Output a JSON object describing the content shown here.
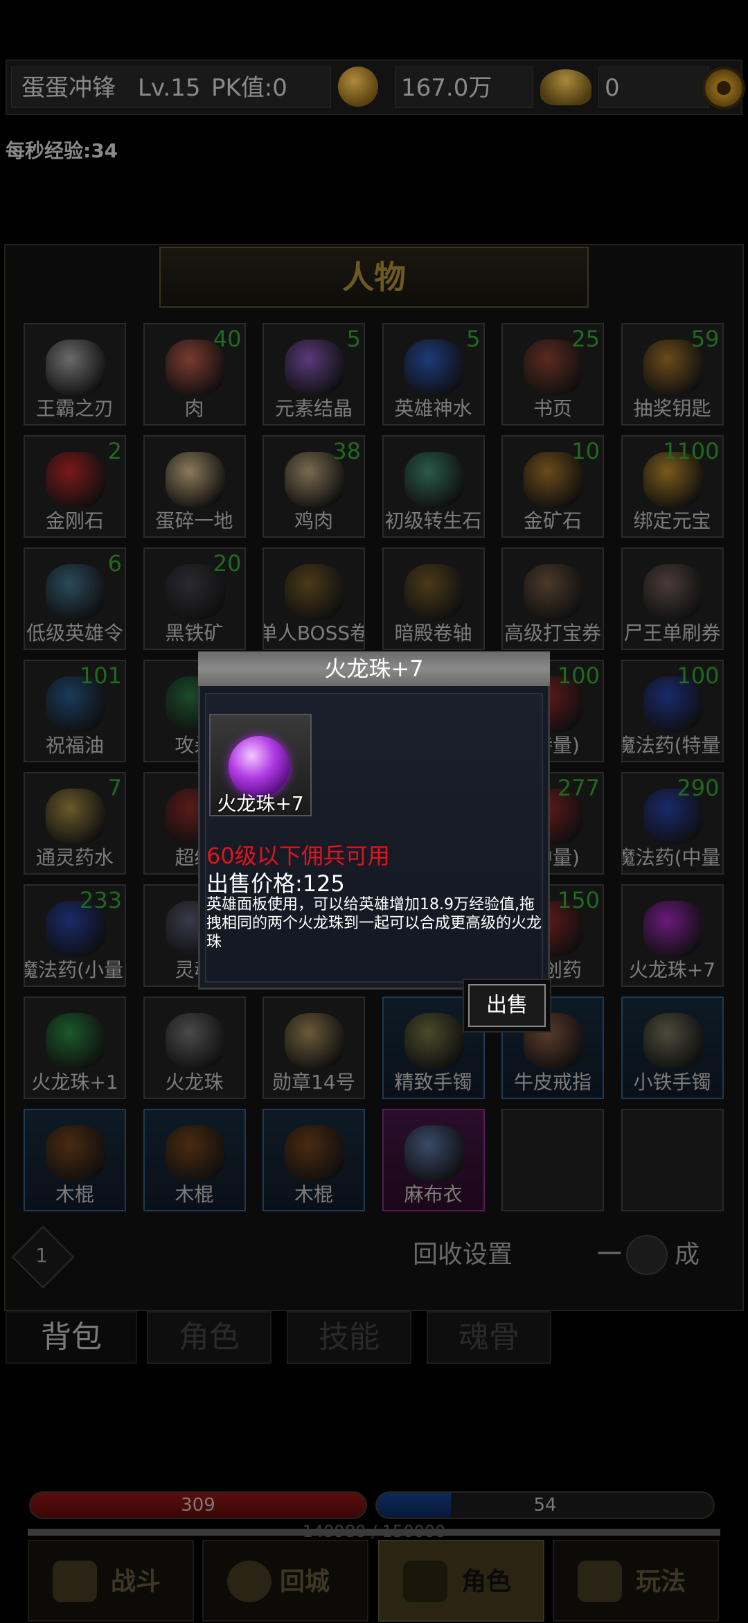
{
  "header": {
    "player_name": "蛋蛋冲锋",
    "level": "Lv.15",
    "pk": "PK值:0",
    "gold": "167.0万",
    "ingot": "0",
    "exp_per_sec": "每秒经验:34"
  },
  "panel": {
    "title": "人物",
    "items": [
      {
        "name": "王霸之刃",
        "count": "",
        "color": "#6b6b6b"
      },
      {
        "name": "肉",
        "count": "40",
        "color": "#7a3a30"
      },
      {
        "name": "元素结晶",
        "count": "5",
        "color": "#5a3a7a"
      },
      {
        "name": "英雄神水",
        "count": "5",
        "color": "#1e3a7a"
      },
      {
        "name": "书页",
        "count": "25",
        "color": "#5a2a20"
      },
      {
        "name": "抽奖钥匙",
        "count": "59",
        "color": "#6a4a1a"
      },
      {
        "name": "金刚石",
        "count": "2",
        "color": "#7a1a1a"
      },
      {
        "name": "蛋碎一地",
        "count": "",
        "color": "#8a7a5a"
      },
      {
        "name": "鸡肉",
        "count": "38",
        "color": "#7a6a50"
      },
      {
        "name": "初级转生石",
        "count": "",
        "color": "#2a5a4a"
      },
      {
        "name": "金矿石",
        "count": "10",
        "color": "#6a4a1a"
      },
      {
        "name": "绑定元宝",
        "count": "1100",
        "color": "#7a5a1a"
      },
      {
        "name": "低级英雄令",
        "count": "6",
        "color": "#2a4a5a"
      },
      {
        "name": "黑铁矿",
        "count": "20",
        "color": "#2a2a30"
      },
      {
        "name": "单人BOSS卷",
        "count": "",
        "color": "#4a3a1a"
      },
      {
        "name": "暗殿卷轴",
        "count": "",
        "color": "#4a3a1a"
      },
      {
        "name": "高级打宝券",
        "count": "",
        "color": "#4a3a2a"
      },
      {
        "name": "尸王单刷券",
        "count": "",
        "color": "#4a3a3a"
      },
      {
        "name": "祝福油",
        "count": "101",
        "color": "#1a3a5a"
      },
      {
        "name": "攻杀",
        "count": "",
        "color": "#1a4a2a"
      },
      {
        "name": "",
        "count": "",
        "color": "#141414"
      },
      {
        "name": "",
        "count": "",
        "color": "#141414"
      },
      {
        "name": "(特量)",
        "count": "100",
        "color": "#5a1a1a"
      },
      {
        "name": "魔法药(特量)",
        "count": "100",
        "color": "#1a2a6a"
      },
      {
        "name": "通灵药水",
        "count": "7",
        "color": "#6a5a2a"
      },
      {
        "name": "超级",
        "count": "",
        "color": "#5a1a1a"
      },
      {
        "name": "",
        "count": "",
        "color": "#141414"
      },
      {
        "name": "",
        "count": "",
        "color": "#141414"
      },
      {
        "name": "(中量)",
        "count": "277",
        "color": "#5a1a1a"
      },
      {
        "name": "魔法药(中量)",
        "count": "290",
        "color": "#1a2a6a"
      },
      {
        "name": "魔法药(小量)",
        "count": "233",
        "color": "#1a2a6a"
      },
      {
        "name": "灵魂",
        "count": "",
        "color": "#3a3a4a"
      },
      {
        "name": "",
        "count": "",
        "color": "#141414"
      },
      {
        "name": "",
        "count": "",
        "color": "#141414"
      },
      {
        "name": "金创药",
        "count": "150",
        "color": "#5a1a1a"
      },
      {
        "name": "火龙珠+7",
        "count": "",
        "color": "#6a1a7a"
      },
      {
        "name": "火龙珠+1",
        "count": "",
        "color": "#1a5a2a"
      },
      {
        "name": "火龙珠",
        "count": "",
        "color": "#4a4a4a"
      },
      {
        "name": "勋章14号",
        "count": "",
        "color": "#6a5a3a"
      },
      {
        "name": "精致手镯",
        "count": "",
        "color": "#4a4a2a"
      },
      {
        "name": "牛皮戒指",
        "count": "",
        "color": "#5a3a2a"
      },
      {
        "name": "小铁手镯",
        "count": "",
        "color": "#4a4a3a"
      },
      {
        "name": "木棍",
        "count": "",
        "color": "#4a2a10"
      },
      {
        "name": "木棍",
        "count": "",
        "color": "#4a2a10"
      },
      {
        "name": "木棍",
        "count": "",
        "color": "#4a2a10"
      },
      {
        "name": "麻布衣",
        "count": "",
        "color": "#3a4a6a"
      },
      {
        "name": "",
        "count": "",
        "color": "#141414"
      },
      {
        "name": "",
        "count": "",
        "color": "#141414"
      }
    ],
    "page": "1",
    "recycle_label": "回收设置",
    "onekey_left": "一",
    "onekey_right": "成"
  },
  "tabs": [
    "背包",
    "角色",
    "技能",
    "魂骨"
  ],
  "stats": {
    "hp": "309",
    "mp": "54",
    "exp": "149980 / 150000",
    "hp_fill": 1.0,
    "mp_fill": 0.22,
    "exp_fill": 0.9999
  },
  "nav": [
    "战斗",
    "回城",
    "角色",
    "玩法"
  ],
  "popup": {
    "title": "火龙珠+7",
    "item_name": "火龙珠+7",
    "requirement": "60级以下佣兵可用",
    "price": "出售价格:125",
    "description": "英雄面板使用，可以给英雄增加18.9万经验值,拖拽相同的两个火龙珠到一起可以合成更高级的火龙珠",
    "sell_button": "出售"
  }
}
